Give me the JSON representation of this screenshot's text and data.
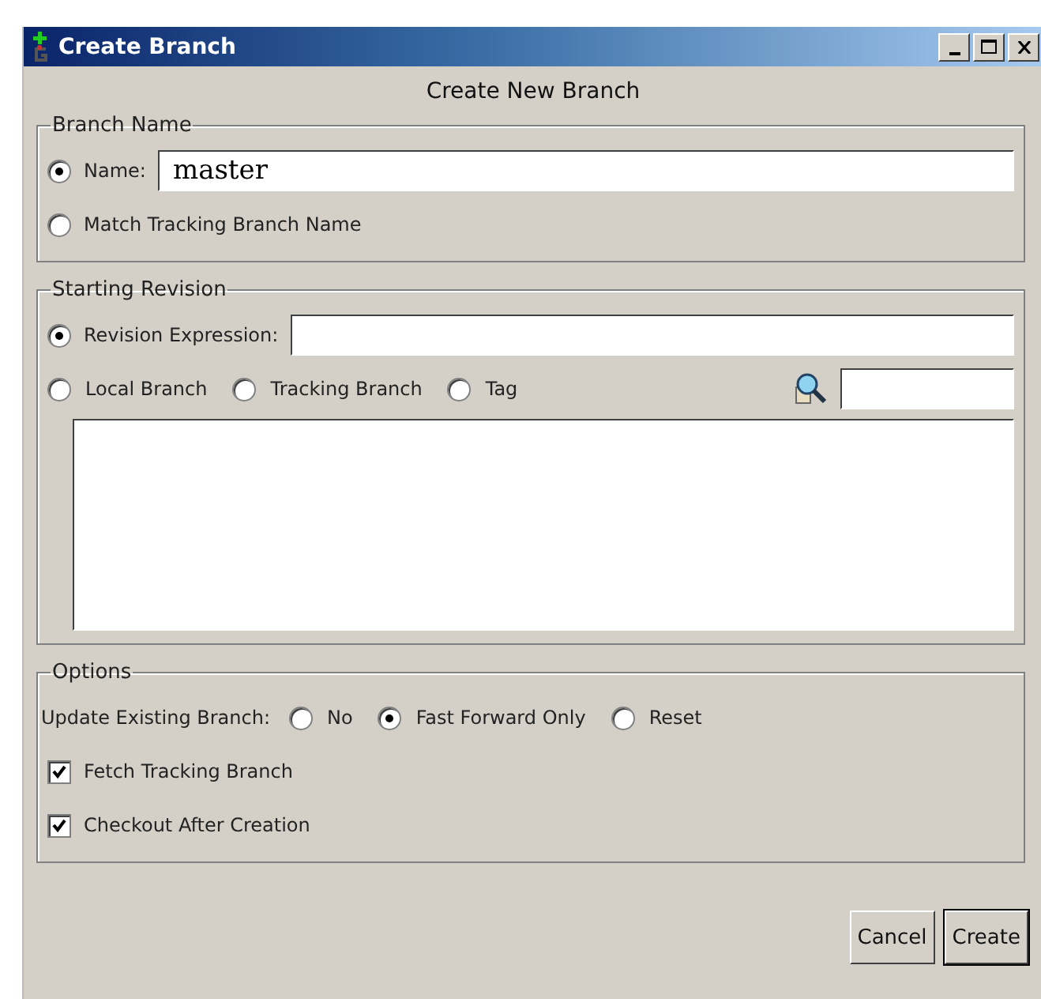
{
  "window": {
    "title": "Create Branch"
  },
  "heading": "Create New Branch",
  "branch_name": {
    "legend": "Branch Name",
    "options": [
      {
        "label": "Name:",
        "selected": true,
        "kind": "field",
        "value": "master"
      },
      {
        "label": "Match Tracking Branch Name",
        "selected": false,
        "kind": "plain"
      }
    ]
  },
  "starting_revision": {
    "legend": "Starting Revision",
    "expression": {
      "label": "Revision Expression:",
      "selected": true
    },
    "sources": [
      {
        "label": "Local Branch",
        "selected": false
      },
      {
        "label": "Tracking Branch",
        "selected": false
      },
      {
        "label": "Tag",
        "selected": false
      }
    ]
  },
  "options": {
    "legend": "Options",
    "update_label": "Update Existing Branch:",
    "update_choices": [
      {
        "label": "No",
        "selected": false
      },
      {
        "label": "Fast Forward Only",
        "selected": true
      },
      {
        "label": "Reset",
        "selected": false
      }
    ],
    "checkboxes": [
      {
        "label": "Fetch Tracking Branch",
        "checked": true
      },
      {
        "label": "Checkout After Creation",
        "checked": true
      }
    ]
  },
  "buttons": [
    {
      "label": "Cancel",
      "default": false
    },
    {
      "label": "Create",
      "default": true
    }
  ]
}
